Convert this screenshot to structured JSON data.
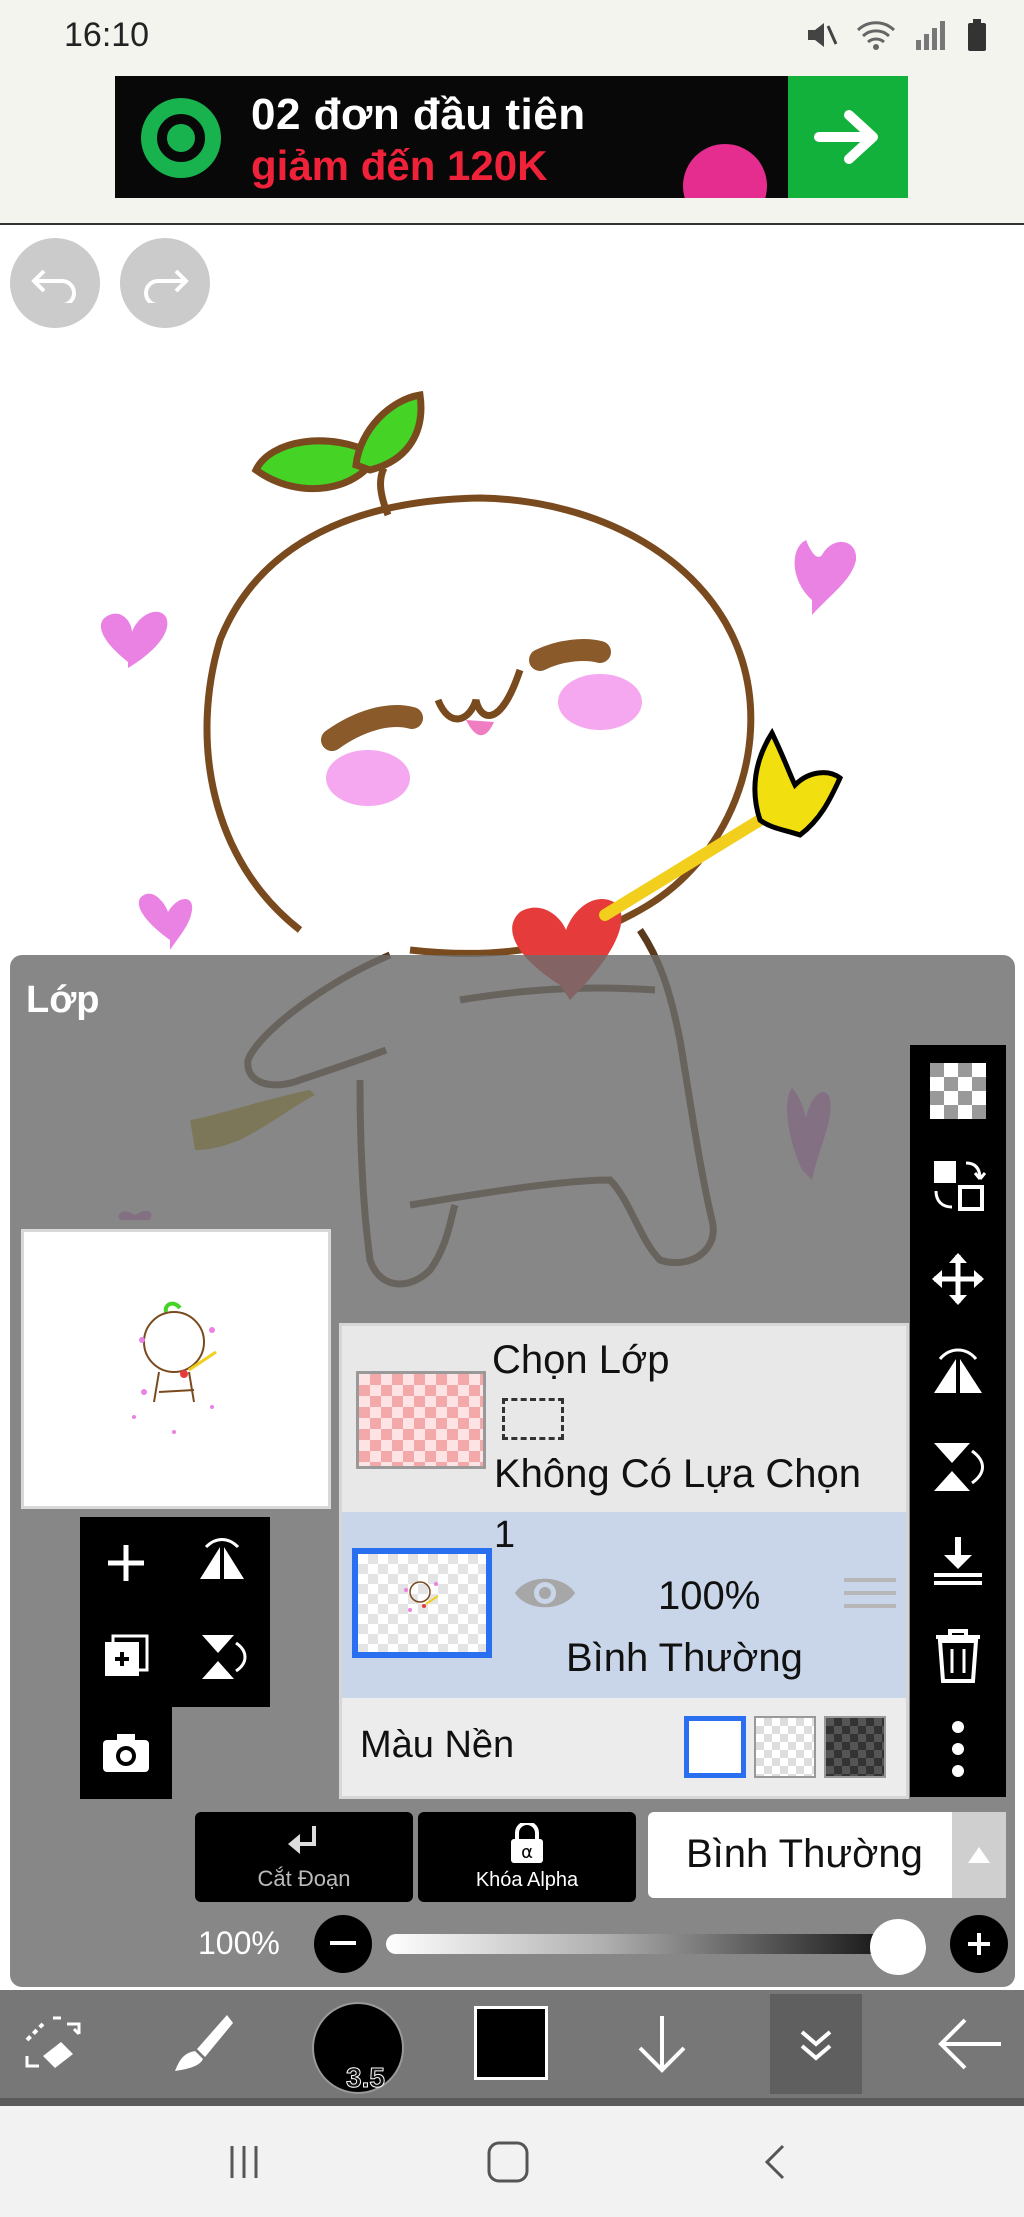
{
  "status_bar": {
    "time": "16:10",
    "icons": [
      "mute-icon",
      "wifi-icon",
      "signal-icon",
      "battery-icon"
    ]
  },
  "ad": {
    "line1": "02 đơn đầu tiên",
    "line2": "giảm đến 120K",
    "colors": {
      "brand": "#18b24f",
      "highlight": "#f0223a",
      "arrow_bg": "#12b13b"
    }
  },
  "canvas_controls": {
    "undo_icon": "undo-icon",
    "redo_icon": "redo-icon"
  },
  "layer_panel": {
    "title": "Lớp",
    "selection_row": {
      "title": "Chọn Lớp",
      "subtitle": "Không Có Lựa Chọn"
    },
    "layers": [
      {
        "number": "1",
        "opacity": "100%",
        "blend_mode": "Bình Thường",
        "visible": true,
        "selected": true
      }
    ],
    "background_row": {
      "label": "Màu Nền",
      "options": [
        "white",
        "transparent",
        "dark"
      ],
      "selected": "white"
    },
    "left_tools": [
      "add-layer-icon",
      "flip-horizontal-icon",
      "add-layer-copy-icon",
      "flip-vertical-icon",
      "camera-icon"
    ],
    "right_tools": [
      "transparency-icon",
      "swap-layer-icon",
      "move-icon",
      "flip-horizontal-icon",
      "flip-vertical-icon",
      "merge-down-icon",
      "trash-icon",
      "more-icon"
    ],
    "actions": {
      "clip_label": "Cắt Đoạn",
      "alpha_lock_label": "Khóa Alpha",
      "blend_mode_value": "Bình Thường"
    },
    "opacity_label": "100%",
    "opacity_value": 1.0
  },
  "bottom_toolbar": {
    "brush_size": "3.5",
    "current_color": "#000000",
    "tools": [
      "eraser-swap-icon",
      "brush-icon",
      "brush-size",
      "color-swatch",
      "down-arrow-icon",
      "collapse-icon",
      "back-icon"
    ]
  },
  "nav_bar": {
    "buttons": [
      "recent-apps-icon",
      "home-icon",
      "back-nav-icon"
    ]
  }
}
